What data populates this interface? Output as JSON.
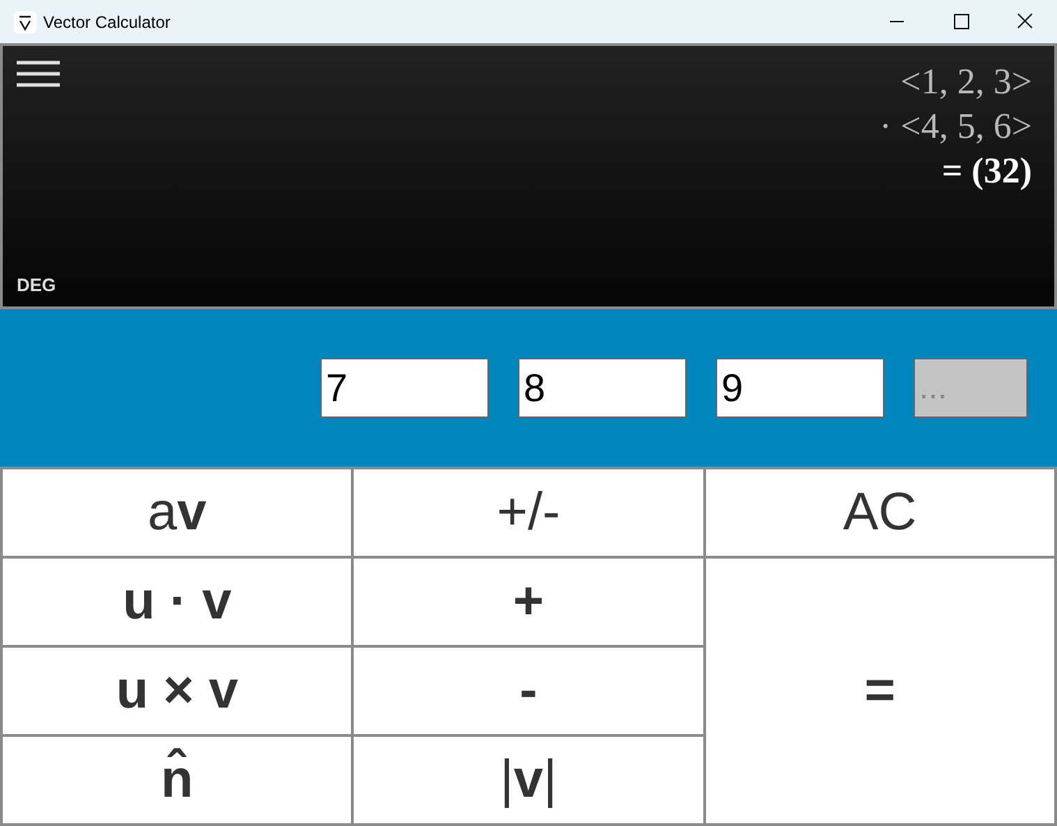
{
  "window": {
    "title": "Vector Calculator"
  },
  "display": {
    "lines": [
      {
        "text": "<1, 2, 3>",
        "kind": "operand"
      },
      {
        "text": "· <4, 5, 6>",
        "kind": "operand"
      },
      {
        "text": "= (32)",
        "kind": "result"
      }
    ],
    "mode": "DEG"
  },
  "inputs": [
    {
      "value": "7",
      "disabled": false
    },
    {
      "value": "8",
      "disabled": false
    },
    {
      "value": "9",
      "disabled": false
    },
    {
      "placeholder": "...",
      "disabled": true
    }
  ],
  "keys": [
    {
      "label": "a**v**",
      "kind": "normal"
    },
    {
      "label": "+/-",
      "kind": "normal"
    },
    {
      "label": "AC",
      "kind": "normal"
    },
    {
      "label": "**u · v**",
      "kind": "normal"
    },
    {
      "label": "**+**",
      "kind": "normal"
    },
    {
      "label": "**u × v**",
      "kind": "normal"
    },
    {
      "label": "**-**",
      "kind": "normal"
    },
    {
      "label": "=",
      "kind": "tall"
    },
    {
      "label": "**n̂**",
      "kind": "normal"
    },
    {
      "label": "|**v**|",
      "kind": "normal"
    }
  ]
}
